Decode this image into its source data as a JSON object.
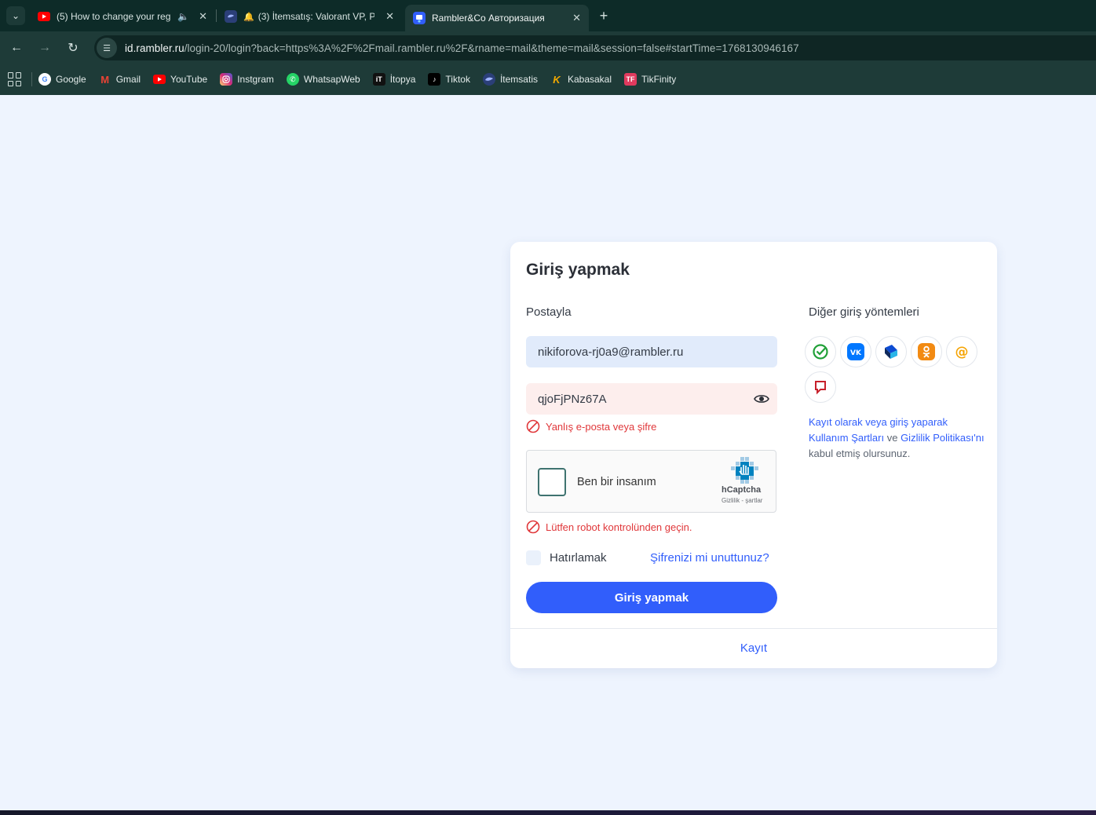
{
  "browser": {
    "tabs": [
      {
        "title": "(5) How to change your reg",
        "icon": "youtube-icon",
        "audio": true
      },
      {
        "title": "(3) İtemsatış: Valorant VP, P",
        "icon": "itemsatis-icon",
        "bell": true
      },
      {
        "title": "Rambler&Co Авторизация",
        "icon": "rambler-icon",
        "active": true
      }
    ],
    "url_host": "id.rambler.ru",
    "url_path": "/login-20/login?back=https%3A%2F%2Fmail.rambler.ru%2F&rname=mail&theme=mail&session=false#startTime=1768130946167",
    "bookmarks": [
      {
        "label": "Google",
        "icon": "google-icon",
        "color": "#4285f4"
      },
      {
        "label": "Gmail",
        "icon": "gmail-icon",
        "color": "#ea4335"
      },
      {
        "label": "YouTube",
        "icon": "youtube-icon",
        "color": "#ff0000"
      },
      {
        "label": "Instgram",
        "icon": "instagram-icon",
        "color": "#d62976"
      },
      {
        "label": "WhatsapWeb",
        "icon": "whatsapp-icon",
        "color": "#25d366"
      },
      {
        "label": "İtopya",
        "icon": "itopya-icon",
        "color": "#111111"
      },
      {
        "label": "Tiktok",
        "icon": "tiktok-icon",
        "color": "#000000"
      },
      {
        "label": "İtemsatis",
        "icon": "itemsatis-icon",
        "color": "#3b5bdb"
      },
      {
        "label": "Kabasakal",
        "icon": "kabasakal-icon",
        "color": "#f2a900"
      },
      {
        "label": "TikFinity",
        "icon": "tikfinity-icon",
        "color": "#e03a5e"
      }
    ]
  },
  "login": {
    "title": "Giriş yapmak",
    "mail_label": "Postayla",
    "email_value": "nikiforova-rj0a9@rambler.ru",
    "password_value": "qjoFjPNz67A",
    "password_error": "Yanlış e-posta veya şifre",
    "captcha_label": "Ben bir insanım",
    "captcha_brand": "hCaptcha",
    "captcha_links": "Gizlilik - şartlar",
    "captcha_error": "Lütfen robot kontrolünden geçin.",
    "remember_label": "Hatırlamak",
    "forgot_link": "Şifrenizi mi unuttunuz?",
    "submit_label": "Giriş yapmak",
    "register_link": "Kayıt"
  },
  "other_methods": {
    "label": "Diğer giriş yöntemleri",
    "providers": [
      "sber-id-icon",
      "vk-icon",
      "gosuslugi-icon",
      "odnoklassniki-icon",
      "mailru-icon",
      "yandex-icon"
    ],
    "terms_prefix": "Kayıt olarak veya giriş yaparak",
    "terms_link1": "Kullanım Şartları",
    "terms_and": " ve ",
    "terms_link2": "Gizlilik Politikası'nı",
    "terms_suffix": " kabul etmiş olursunuz."
  },
  "colors": {
    "accent": "#315efb",
    "error": "#e0373a",
    "chrome": "#1e3b38"
  }
}
